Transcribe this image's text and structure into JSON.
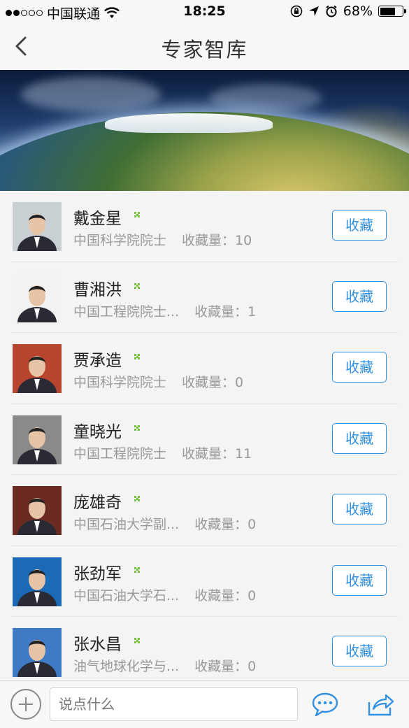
{
  "status": {
    "carrier": "中国联通",
    "time": "18:25",
    "battery": "68%",
    "battery_level": 0.68,
    "signal_icon": "signal-dots",
    "wifi_icon": "wifi-icon"
  },
  "nav": {
    "title": "专家智库",
    "back_icon": "chevron-left-icon"
  },
  "banner": {
    "image": "earth-sunrise-banner"
  },
  "experts": [
    {
      "name": "戴金星",
      "title": "中国科学院院士",
      "favorites": "收藏量：10",
      "button": "收藏",
      "avatar_bg": "#c8d0d4"
    },
    {
      "name": "曹湘洪",
      "title": "中国工程院院士...",
      "favorites": "收藏量：1",
      "button": "收藏",
      "avatar_bg": "#f2f2f2"
    },
    {
      "name": "贾承造",
      "title": "中国科学院院士",
      "favorites": "收藏量：0",
      "button": "收藏",
      "avatar_bg": "#b8452e"
    },
    {
      "name": "童晓光",
      "title": "中国工程院院士",
      "favorites": "收藏量：11",
      "button": "收藏",
      "avatar_bg": "#8a8a8a"
    },
    {
      "name": "庞雄奇",
      "title": "中国石油大学副...",
      "favorites": "收藏量：0",
      "button": "收藏",
      "avatar_bg": "#6b2a22"
    },
    {
      "name": "张劲军",
      "title": "中国石油大学石...",
      "favorites": "收藏量：0",
      "button": "收藏",
      "avatar_bg": "#1a6ab5"
    },
    {
      "name": "张水昌",
      "title": "油气地球化学与...",
      "favorites": "收藏量：0",
      "button": "收藏",
      "avatar_bg": "#3f7ac4"
    }
  ],
  "bottom": {
    "placeholder": "说点什么",
    "plus_icon": "plus-circle-icon",
    "chat_icon": "chat-bubble-icon",
    "share_icon": "share-icon"
  },
  "colors": {
    "accent": "#2f8fe0",
    "dot": "#7cc242"
  }
}
